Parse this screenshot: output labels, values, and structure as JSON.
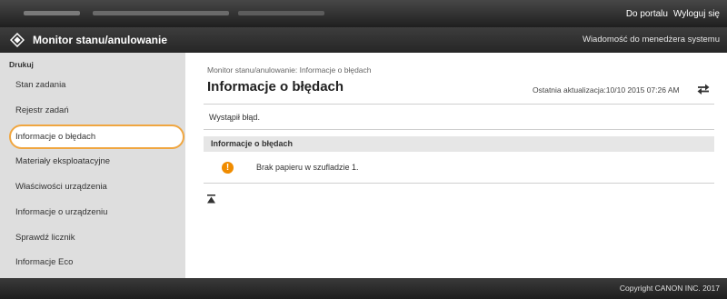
{
  "header": {
    "portal_link": "Do portalu",
    "logout_link": "Wyloguj się"
  },
  "titlebar": {
    "app_title": "Monitor stanu/anulowanie",
    "system_message_link": "Wiadomość do menedżera systemu"
  },
  "sidebar": {
    "heading": "Drukuj",
    "items": [
      {
        "label": "Stan zadania"
      },
      {
        "label": "Rejestr zadań"
      },
      {
        "label": "Informacje o błędach"
      },
      {
        "label": "Materiały eksploatacyjne"
      },
      {
        "label": "Właściwości urządzenia"
      },
      {
        "label": "Informacje o urządzeniu"
      },
      {
        "label": "Sprawdź licznik"
      },
      {
        "label": "Informacje Eco"
      }
    ],
    "selected_index": 2
  },
  "main": {
    "breadcrumb": "Monitor stanu/anulowanie: Informacje o błędach",
    "page_title": "Informacje o błędach",
    "last_update": "Ostatnia aktualizacja:10/10 2015 07:26 AM",
    "error_notice": "Wystąpił błąd.",
    "section_title": "Informacje o błędach",
    "error_message": "Brak papieru w szufladzie 1."
  },
  "footer": {
    "copyright": "Copyright CANON INC. 2017"
  },
  "colors": {
    "selection_outline": "#f0a640",
    "warning_icon": "#f08c00",
    "header_bg": "#2a2a2a",
    "sidebar_bg": "#dedede"
  },
  "icons": [
    "canon-logo-icon",
    "refresh-icon",
    "warning-icon",
    "scroll-to-top-icon"
  ]
}
